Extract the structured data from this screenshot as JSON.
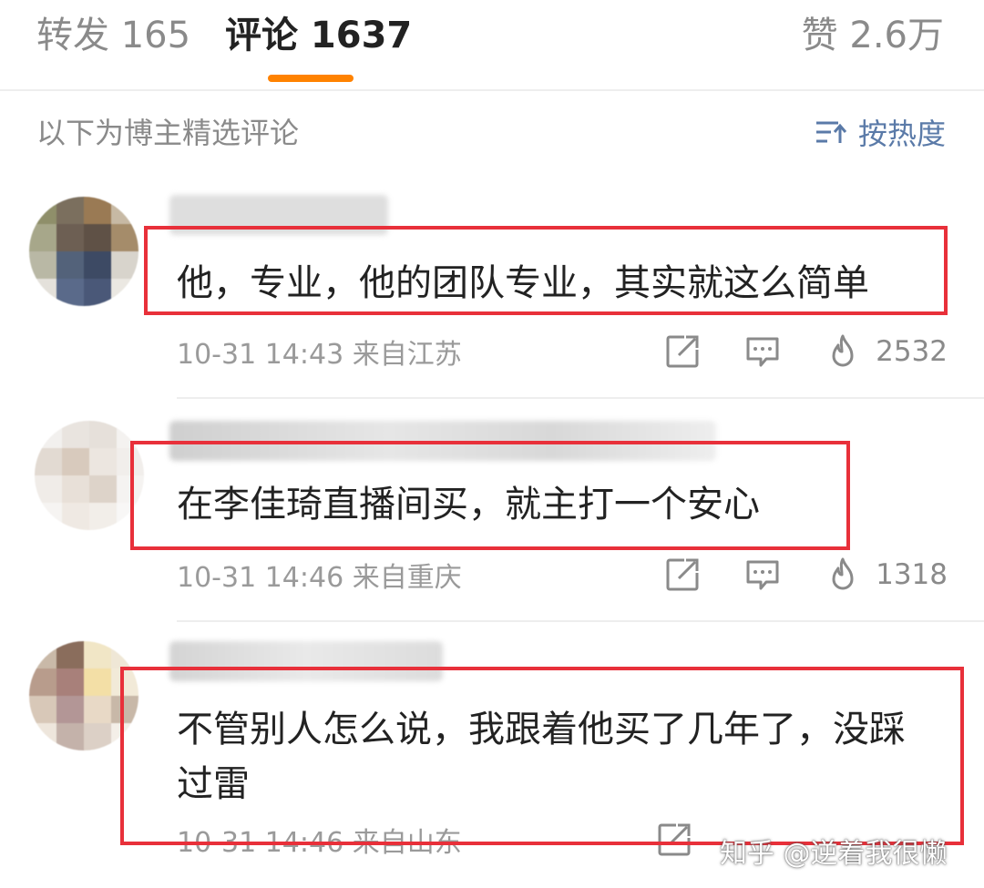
{
  "tabs": {
    "repost_label": "转发 165",
    "comments_label": "评论 1637",
    "likes_label": "赞 2.6万",
    "accent": "#ff8200"
  },
  "filter": {
    "label": "以下为博主精选评论",
    "sort_label": "按热度",
    "sort_icon": "sort-lines-arrow-icon"
  },
  "comments": [
    {
      "text": "他，专业，他的团队专业，其实就这么简单",
      "meta": "10-31 14:43 来自江苏",
      "likes": "2532"
    },
    {
      "text": "在李佳琦直播间买，就主打一个安心",
      "meta": "10-31 14:46 来自重庆",
      "likes": "1318"
    },
    {
      "text_line1": "不管别人怎么说，我跟着他买了几年了，没踩",
      "text_line2": "过雷",
      "meta": "10-31 14:46 来自山东"
    }
  ],
  "action_icons": [
    "share-icon",
    "reply-icon",
    "like-flame-icon"
  ],
  "highlight_color": "#e8303a",
  "watermark": "知乎 @逆着我很懒"
}
